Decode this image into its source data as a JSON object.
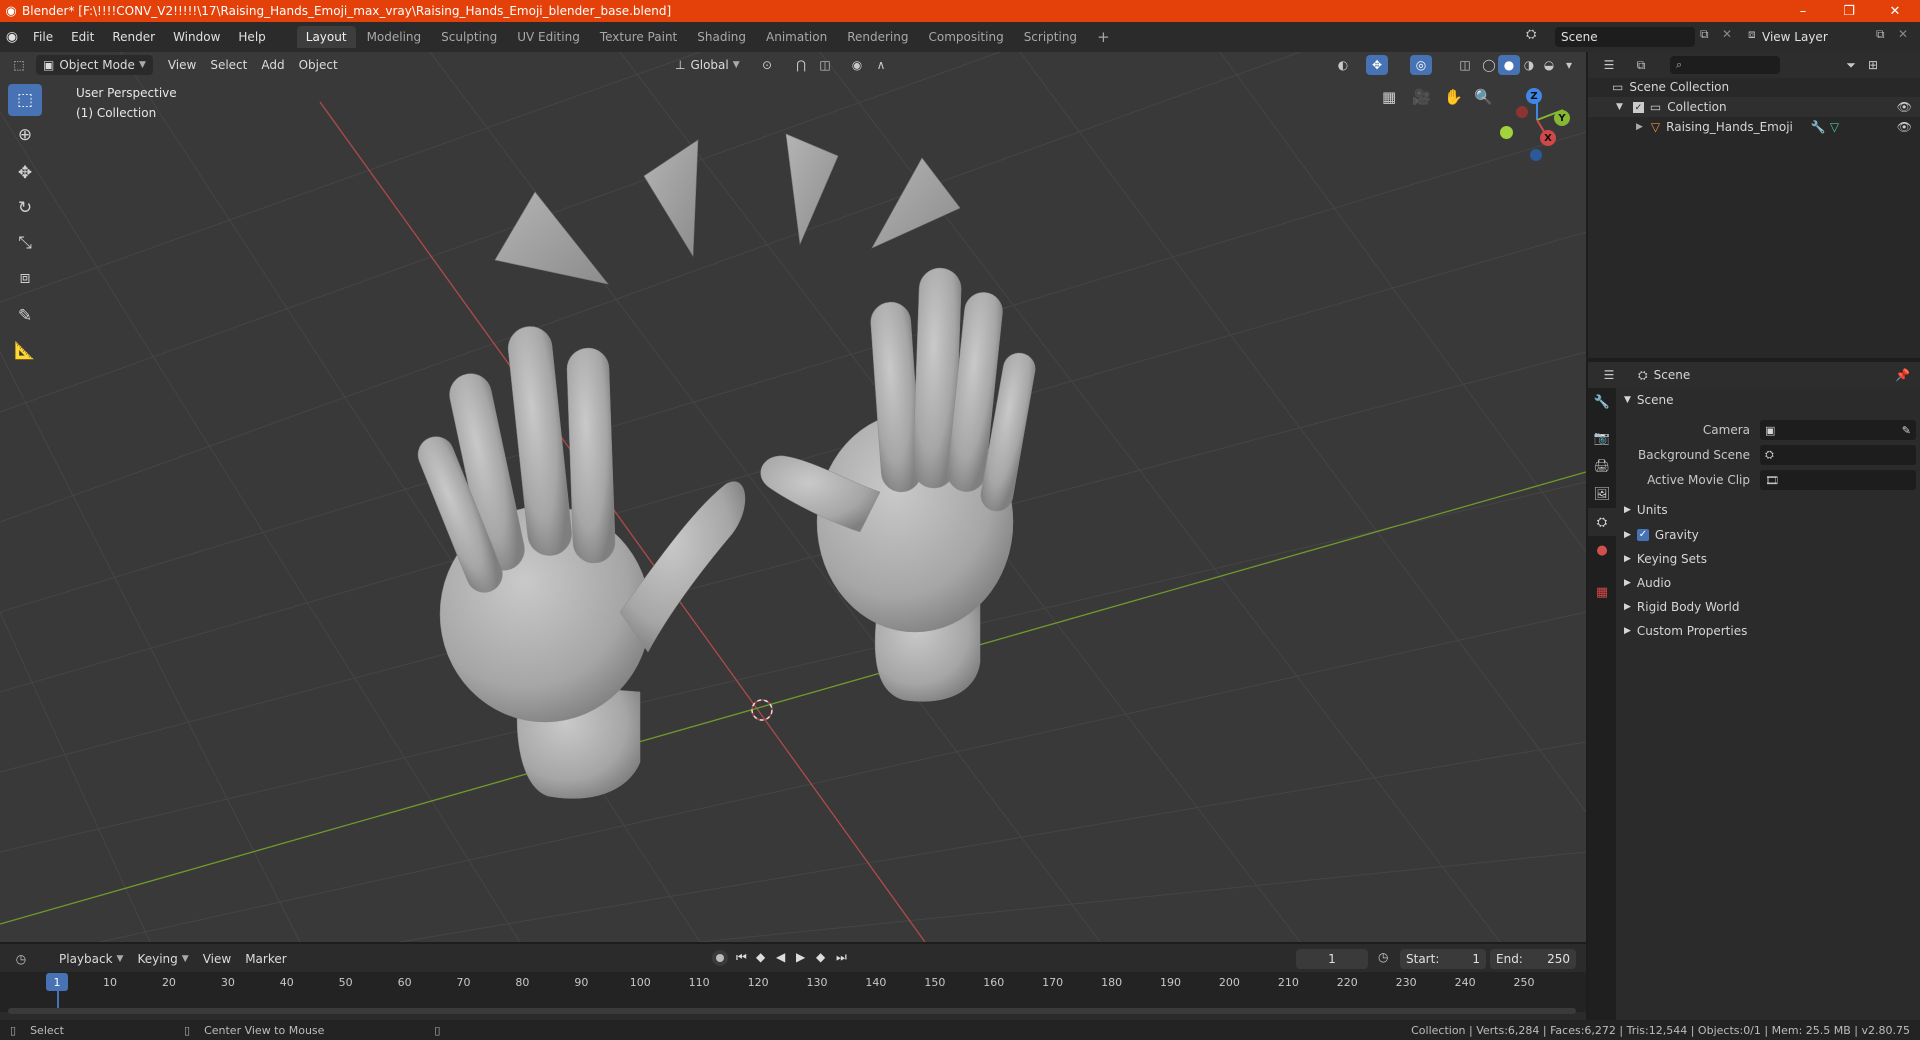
{
  "window": {
    "title": "Blender* [F:\\!!!!CONV_V2!!!!!\\17\\Raising_Hands_Emoji_max_vray\\Raising_Hands_Emoji_blender_base.blend]",
    "minimize": "–",
    "maximize": "❐",
    "close": "✕"
  },
  "menu": [
    "File",
    "Edit",
    "Render",
    "Window",
    "Help"
  ],
  "workspaces": [
    "Layout",
    "Modeling",
    "Sculpting",
    "UV Editing",
    "Texture Paint",
    "Shading",
    "Animation",
    "Rendering",
    "Compositing",
    "Scripting"
  ],
  "add_workspace": "+",
  "scene_field": "Scene",
  "view_layer_field": "View Layer",
  "viewport": {
    "mode": "Object Mode",
    "menus": [
      "View",
      "Select",
      "Add",
      "Object"
    ],
    "transform_orientation": "Global",
    "perspective_label": "User Perspective",
    "collection_label": "(1) Collection",
    "gizmo": {
      "x": "X",
      "y": "Y",
      "z": "Z"
    }
  },
  "outliner": {
    "search_placeholder": "",
    "scene_collection": "Scene Collection",
    "collection": "Collection",
    "object": "Raising_Hands_Emoji"
  },
  "properties": {
    "context": "Scene",
    "panel_title": "Scene",
    "camera_label": "Camera",
    "background_scene_label": "Background Scene",
    "active_movie_clip_label": "Active Movie Clip",
    "sections": [
      "Units",
      "Gravity",
      "Keying Sets",
      "Audio",
      "Rigid Body World",
      "Custom Properties"
    ]
  },
  "timeline": {
    "menus": [
      "Playback",
      "Keying",
      "View",
      "Marker"
    ],
    "current_frame": "1",
    "start_label": "Start:",
    "start_value": "1",
    "end_label": "End:",
    "end_value": "250",
    "ticks": [
      "1",
      "10",
      "20",
      "30",
      "40",
      "50",
      "60",
      "70",
      "80",
      "90",
      "100",
      "110",
      "120",
      "130",
      "140",
      "150",
      "160",
      "170",
      "180",
      "190",
      "200",
      "210",
      "220",
      "230",
      "240",
      "250"
    ]
  },
  "status": {
    "left": "Select",
    "middle": "Center View to Mouse",
    "right": "Collection | Verts:6,284 | Faces:6,272 | Tris:12,544 | Objects:0/1 | Mem: 25.5 MB | v2.80.75"
  },
  "colors": {
    "title_bar": "#e4400a",
    "accent_blue": "#4772b3",
    "x_axis": "#d04848",
    "y_axis": "#86b834",
    "z_axis": "#3f86e6"
  }
}
